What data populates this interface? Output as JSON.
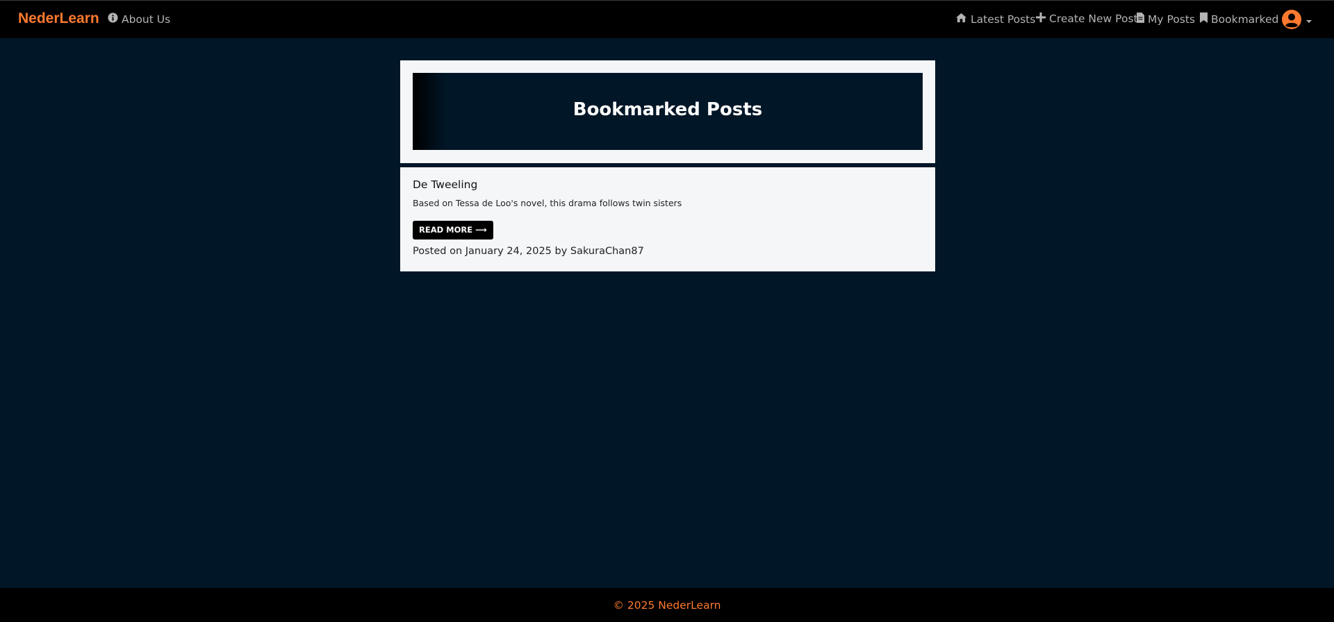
{
  "nav": {
    "brand": "NederLearn",
    "about": "About Us",
    "latest": "Latest Posts",
    "create": "Create New Post",
    "my_posts": "My Posts",
    "bookmarked": "Bookmarked",
    "user_icon": "user-circle-icon",
    "accent_color": "#ff7a2f"
  },
  "page": {
    "title": "Bookmarked Posts"
  },
  "posts": [
    {
      "title": "De Tweeling",
      "excerpt": "Based on Tessa de Loo's novel, this drama follows twin sisters",
      "read_more": "READ MORE ⟶",
      "meta": "Posted on January 24, 2025 by SakuraChan87"
    }
  ],
  "footer": {
    "text": "© 2025 NederLearn"
  }
}
